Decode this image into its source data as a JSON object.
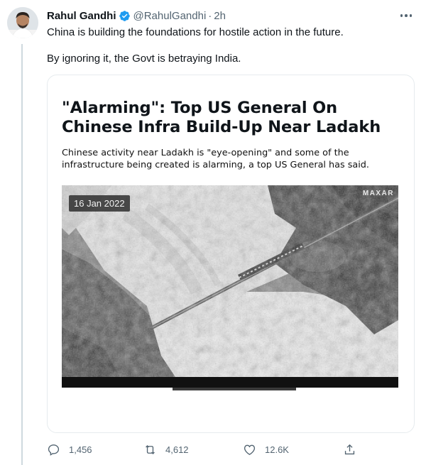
{
  "tweet": {
    "author_name": "Rahul Gandhi",
    "handle": "@RahulGandhi",
    "separator": "·",
    "time": "2h",
    "text_line_1": "China is building the foundations for hostile action in the future.",
    "text_line_2": "By ignoring it, the Govt is betraying India."
  },
  "card": {
    "headline": "\"Alarming\": Top US General On Chinese Infra Build-Up Near Ladakh",
    "subhead": "Chinese activity near Ladakh is \"eye-opening\" and some of the infrastructure being created is alarming, a top US General has said.",
    "image": {
      "date_label": "16 Jan 2022",
      "watermark": "MAXAR"
    }
  },
  "actions": {
    "reply_count": "1,456",
    "retweet_count": "4,612",
    "like_count": "12.6K"
  },
  "icons": {
    "verified": "verified-badge-icon",
    "more": "more-horizontal-icon",
    "reply": "reply-icon",
    "retweet": "retweet-icon",
    "like": "heart-icon",
    "share": "share-icon"
  },
  "colors": {
    "verified_blue": "#1d9bf0",
    "secondary_text": "#536471",
    "card_border": "#e6ebee"
  }
}
